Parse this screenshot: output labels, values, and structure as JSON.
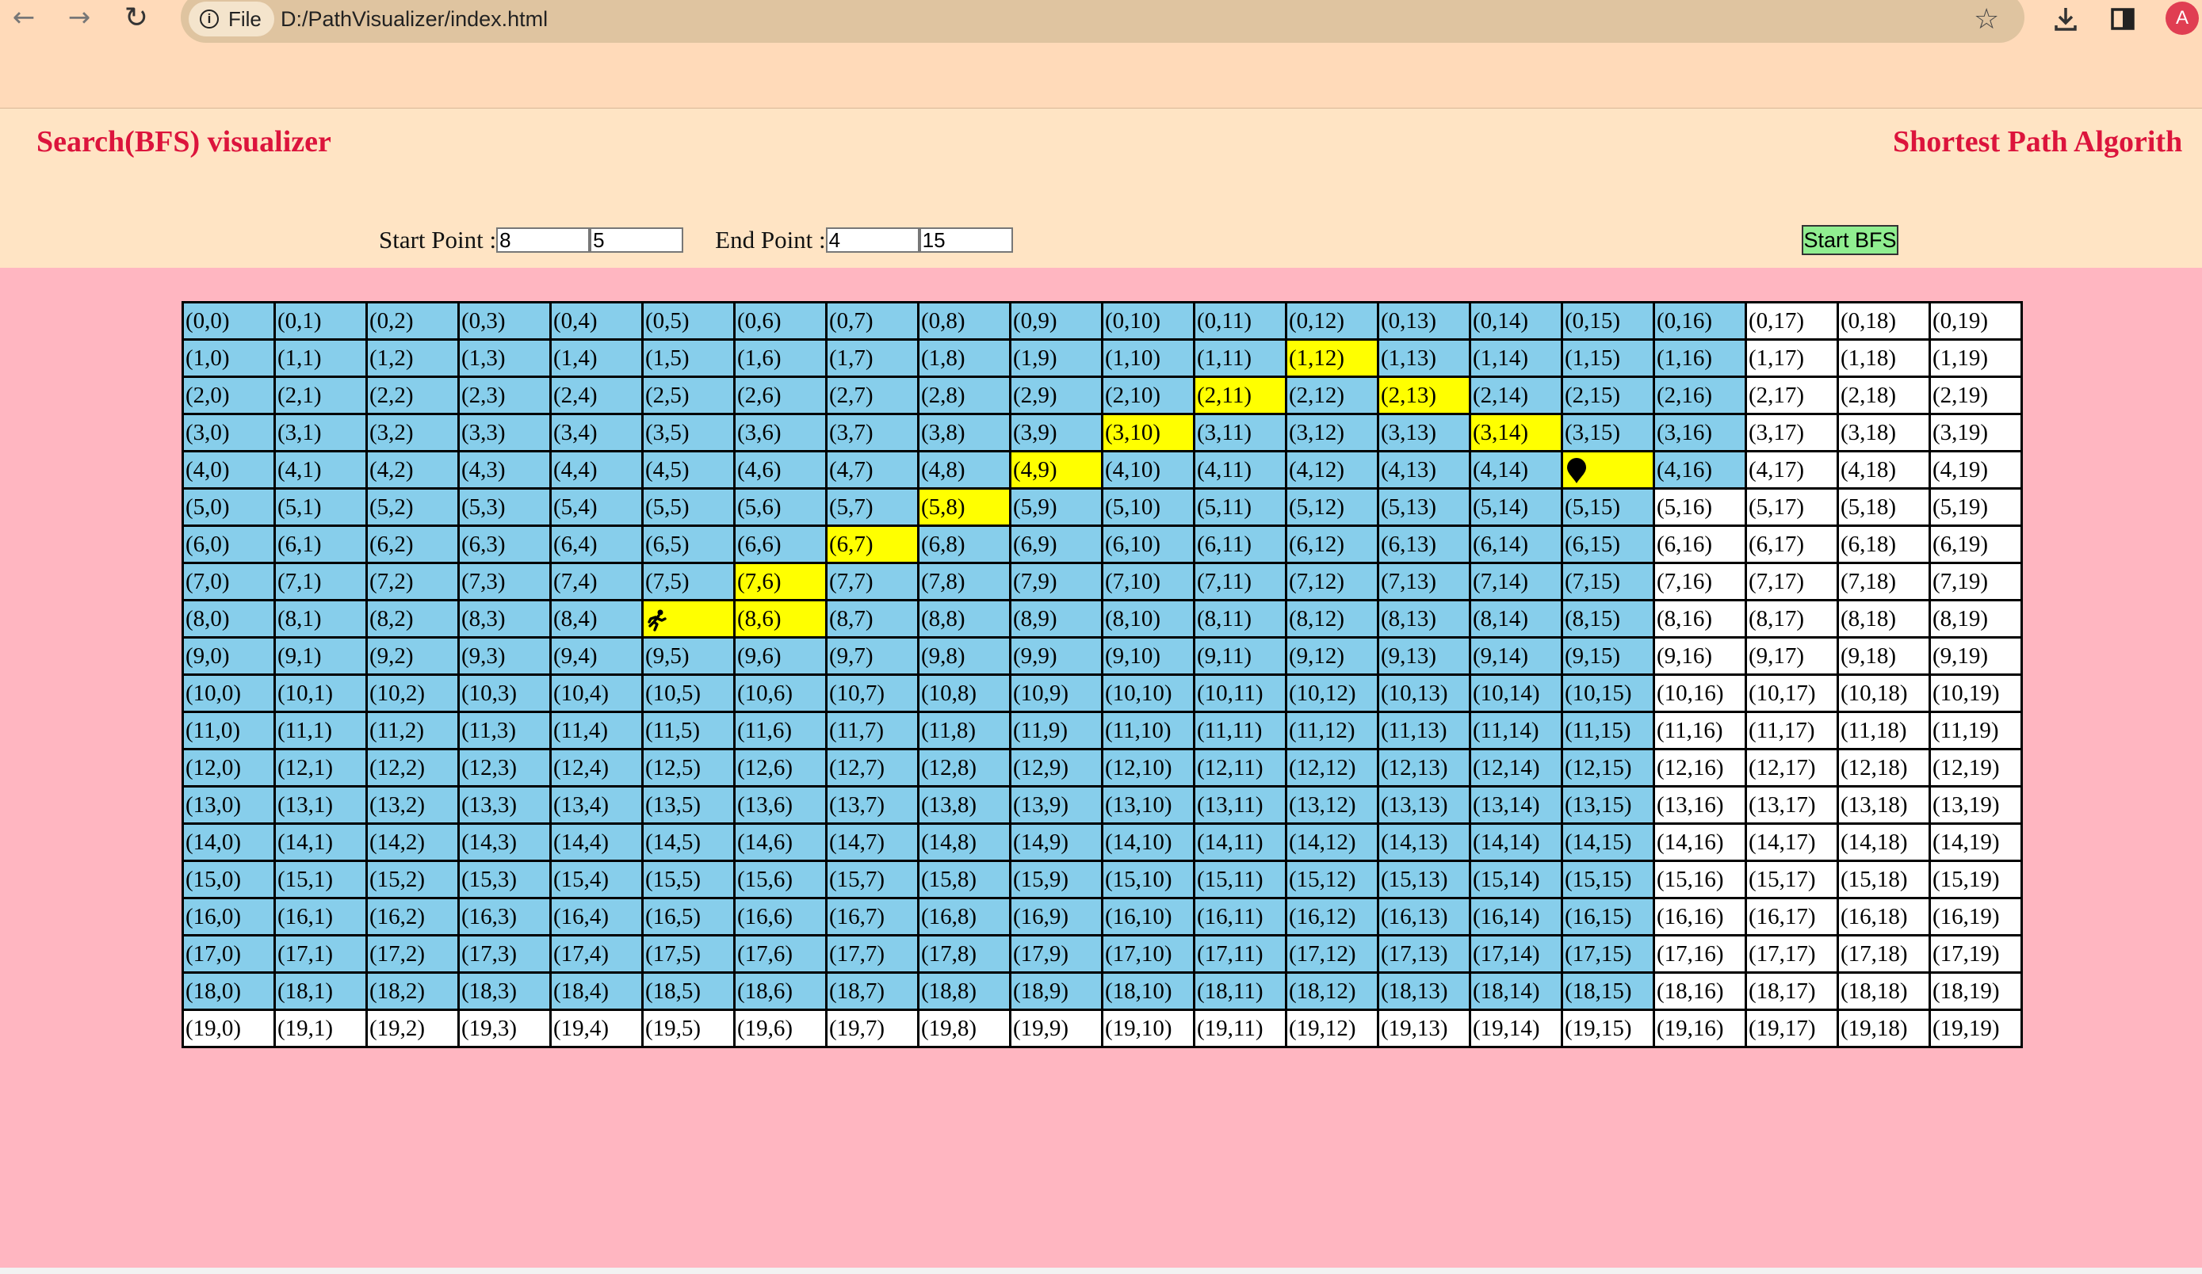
{
  "browser": {
    "site_chip": "File",
    "url": "D:/PathVisualizer/index.html",
    "avatar_letter": "A"
  },
  "header": {
    "title_left": "Search(BFS) visualizer",
    "title_right": "Shortest Path Algorith",
    "title_color": "#dc143c",
    "start_label": "Start Point :",
    "start_row": "8",
    "start_col": "5",
    "end_label": "End Point :",
    "end_row": "4",
    "end_col": "15",
    "button_label": "Start BFS"
  },
  "grid": {
    "rows": 20,
    "cols": 20,
    "visited_cols_by_row": [
      17,
      17,
      17,
      17,
      17,
      16,
      16,
      16,
      16,
      16,
      16,
      16,
      16,
      16,
      16,
      16,
      16,
      16,
      16,
      0
    ],
    "path": [
      [
        8,
        6
      ],
      [
        7,
        6
      ],
      [
        6,
        7
      ],
      [
        5,
        8
      ],
      [
        4,
        9
      ],
      [
        3,
        10
      ],
      [
        2,
        11
      ],
      [
        1,
        12
      ],
      [
        2,
        13
      ],
      [
        3,
        14
      ]
    ],
    "start": [
      8,
      5
    ],
    "end": [
      4,
      15
    ],
    "start_icon": "runner-icon",
    "end_icon": "map-pin-icon",
    "colors": {
      "visited": "#87ceeb",
      "unvisited": "#ffffff",
      "path": "#ffff00",
      "background": "#ffb6c1",
      "header": "#ffe4c4",
      "button": "#90ee90"
    }
  }
}
